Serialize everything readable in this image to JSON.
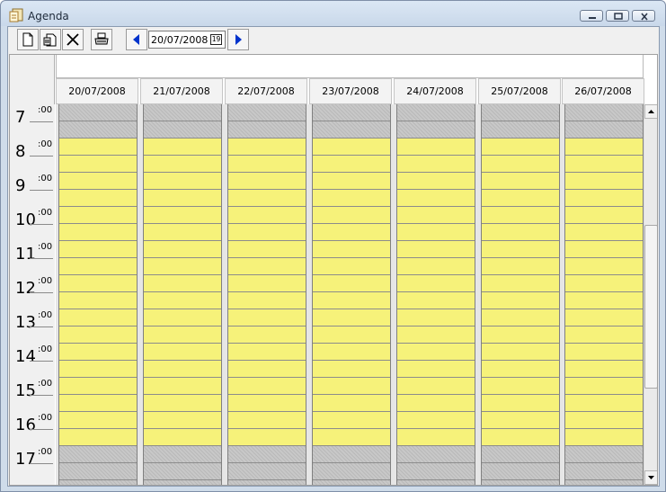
{
  "window": {
    "title": "Agenda"
  },
  "toolbar": {
    "date": "20/07/2008",
    "calendar_day": "19"
  },
  "days": [
    "20/07/2008",
    "21/07/2008",
    "22/07/2008",
    "23/07/2008",
    "24/07/2008",
    "25/07/2008",
    "26/07/2008"
  ],
  "hours": [
    "7",
    "8",
    "9",
    "10",
    "11",
    "12",
    "13",
    "14",
    "15",
    "16",
    "17"
  ],
  "minute_label": ":00",
  "colors": {
    "work_hours": "#f6f27a",
    "off_hours": "#c8c8c8"
  },
  "icons": {
    "new": "new-document-icon",
    "edit": "edit-document-icon",
    "delete": "delete-x-icon",
    "print": "printer-icon",
    "prev": "triangle-left-icon",
    "next": "triangle-right-icon",
    "calendar": "calendar-icon"
  }
}
